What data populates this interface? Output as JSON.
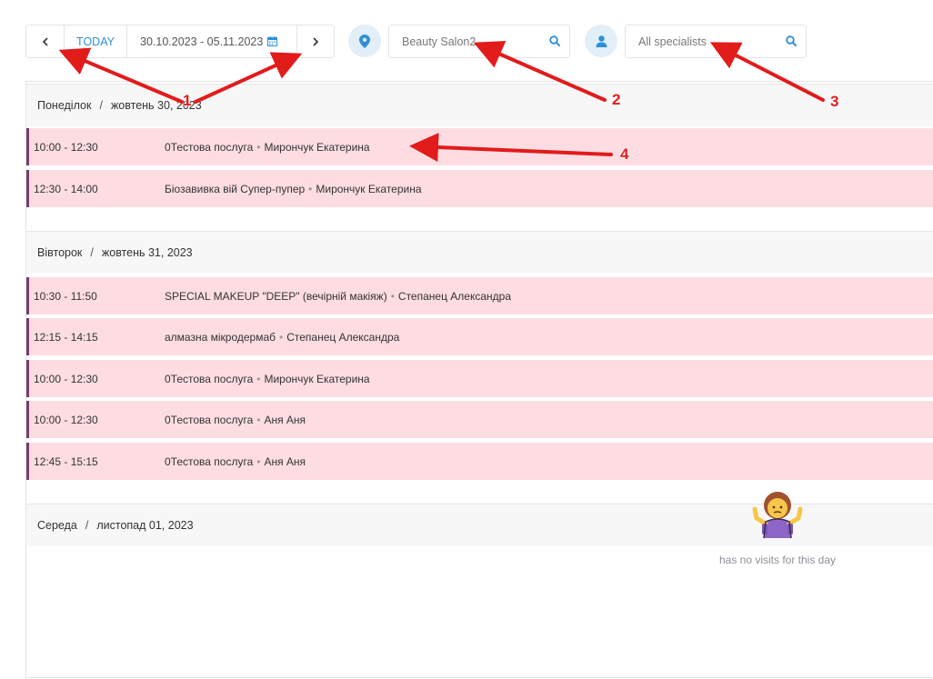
{
  "toolbar": {
    "prev_icon": "chevron-left-icon",
    "today_label": "TODAY",
    "date_range": "30.10.2023 - 05.11.2023",
    "calendar_icon": "calendar-icon",
    "next_icon": "chevron-right-icon",
    "location_icon": "map-pin-icon",
    "location_value": "Beauty Salon2",
    "specialist_icon": "user-icon",
    "specialist_value": "All specialists",
    "search_icon": "search-icon"
  },
  "days": [
    {
      "weekday": "Понеділок",
      "date": "жовтень 30, 2023",
      "visits": [
        {
          "time": "10:00 - 12:30",
          "service": "0Тестова послуга",
          "specialist": "Мирончук Екатерина"
        },
        {
          "time": "12:30 - 14:00",
          "service": "Біозавивка вій Супер-пупер",
          "specialist": "Мирончук Екатерина"
        }
      ]
    },
    {
      "weekday": "Вівторок",
      "date": "жовтень 31, 2023",
      "visits": [
        {
          "time": "10:30 - 11:50",
          "service": "SPECIAL MAKEUP \"DEEP\" (вечірній макіяж)",
          "specialist": "Степанец Александра"
        },
        {
          "time": "12:15 - 14:15",
          "service": "алмазна мікродермаб",
          "specialist": "Степанец Александра"
        },
        {
          "time": "10:00 - 12:30",
          "service": "0Тестова послуга",
          "specialist": "Мирончук Екатерина"
        },
        {
          "time": "10:00 - 12:30",
          "service": "0Тестова послуга",
          "specialist": "Аня Аня"
        },
        {
          "time": "12:45 - 15:15",
          "service": "0Тестова послуга",
          "specialist": "Аня Аня"
        }
      ]
    },
    {
      "weekday": "Середа",
      "date": "листопад 01, 2023",
      "visits": [],
      "empty_icon": "person-shrugging-icon",
      "empty_text": "has no visits for this day"
    }
  ],
  "annotations": [
    "1",
    "2",
    "3",
    "4"
  ],
  "colors": {
    "accent": "#2e8fd8",
    "visit_bg": "#fddde2",
    "visit_border": "#7b3b6a",
    "annotation": "#e21b1b"
  }
}
